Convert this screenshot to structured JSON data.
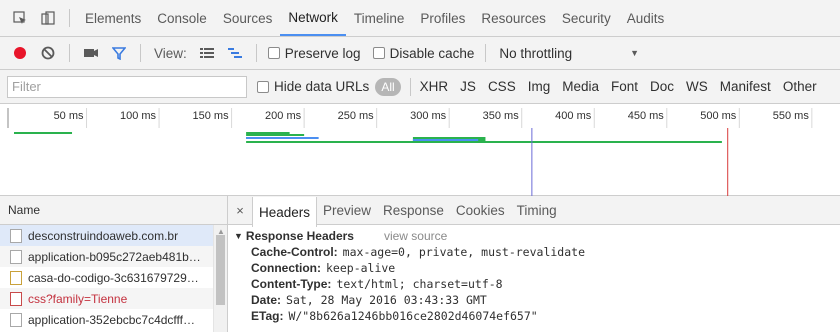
{
  "main_tabs": [
    "Elements",
    "Console",
    "Sources",
    "Network",
    "Timeline",
    "Profiles",
    "Resources",
    "Security",
    "Audits"
  ],
  "active_tab": "Network",
  "toolbar": {
    "view_label": "View:",
    "preserve_log": "Preserve log",
    "disable_cache": "Disable cache",
    "throttling": "No throttling",
    "dropdown_caret": "▼"
  },
  "filter": {
    "placeholder": "Filter",
    "hide_data_urls": "Hide data URLs",
    "all_label": "All",
    "types": [
      "XHR",
      "JS",
      "CSS",
      "Img",
      "Media",
      "Font",
      "Doc",
      "WS",
      "Manifest",
      "Other"
    ]
  },
  "timeline": {
    "ticks": [
      "50 ms",
      "100 ms",
      "150 ms",
      "200 ms",
      "250 ms",
      "300 ms",
      "350 ms",
      "400 ms",
      "450 ms",
      "500 ms",
      "550 ms"
    ],
    "tick_values_ms": [
      50,
      100,
      150,
      200,
      250,
      300,
      350,
      400,
      450,
      500,
      550
    ],
    "bars_ms": [
      {
        "start": 0,
        "end": 40,
        "color": "#2ab24e"
      },
      {
        "start": 160,
        "end": 190,
        "color": "#2ab24e"
      },
      {
        "start": 160,
        "end": 200,
        "color": "#2ab24e"
      },
      {
        "start": 160,
        "end": 205,
        "color": "#2ab24e"
      },
      {
        "start": 160,
        "end": 210,
        "color": "#4b8ff1"
      },
      {
        "start": 160,
        "end": 488,
        "color": "#2ab24e"
      },
      {
        "start": 275,
        "end": 325,
        "color": "#2ab24e"
      },
      {
        "start": 275,
        "end": 325,
        "color": "#2ab24e"
      },
      {
        "start": 275,
        "end": 320,
        "color": "#4b8ff1"
      }
    ],
    "dom_content_loaded_ms": 357,
    "load_ms": 492,
    "colors": {
      "dom_line": "#6b6bd6",
      "load_line": "#d83a3a"
    }
  },
  "requests": {
    "column_name": "Name",
    "items": [
      {
        "name": "desconstruindoaweb.com.br",
        "kind": "doc"
      },
      {
        "name": "application-b095c272aeb481b…",
        "kind": "doc"
      },
      {
        "name": "casa-do-codigo-3c631679729…",
        "kind": "img"
      },
      {
        "name": "css?family=Tienne",
        "kind": "css"
      },
      {
        "name": "application-352ebcbc7c4dcfff…",
        "kind": "doc"
      }
    ]
  },
  "details": {
    "close": "×",
    "tabs": [
      "Headers",
      "Preview",
      "Response",
      "Cookies",
      "Timing"
    ],
    "active_tab": "Headers",
    "section_caret": "▼",
    "section_title": "Response Headers",
    "view_source": "view source",
    "headers": [
      {
        "key": "Cache-Control:",
        "value": "max-age=0, private, must-revalidate"
      },
      {
        "key": "Connection:",
        "value": "keep-alive"
      },
      {
        "key": "Content-Type:",
        "value": "text/html; charset=utf-8"
      },
      {
        "key": "Date:",
        "value": "Sat, 28 May 2016 03:43:33 GMT"
      },
      {
        "key": "ETag:",
        "value": "W/\"8b626a1246bb016ce2802d46074ef657\""
      }
    ]
  }
}
